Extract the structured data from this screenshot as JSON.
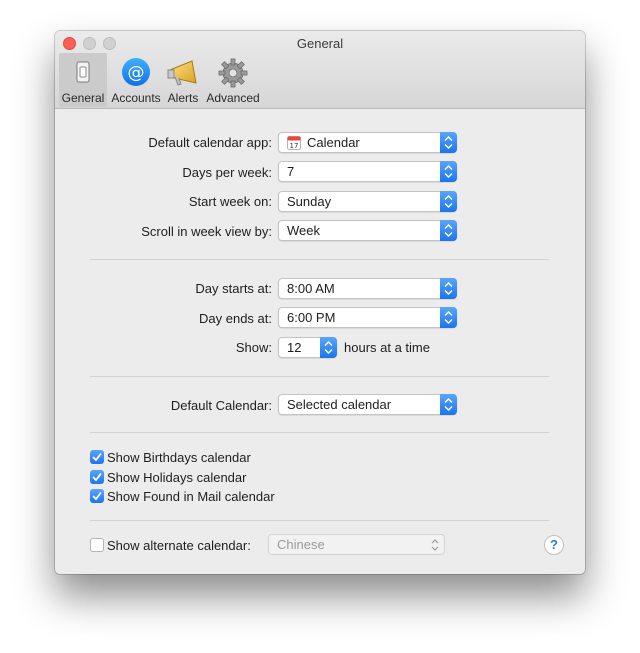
{
  "window": {
    "title": "General"
  },
  "tabs": [
    {
      "label": "General",
      "icon": "switch-icon",
      "selected": true
    },
    {
      "label": "Accounts",
      "icon": "at-sign-icon",
      "selected": false
    },
    {
      "label": "Alerts",
      "icon": "megaphone-icon",
      "selected": false
    },
    {
      "label": "Advanced",
      "icon": "gear-icon",
      "selected": false
    }
  ],
  "general": {
    "default_app_label": "Default calendar app:",
    "default_app_value": "Calendar",
    "days_per_week_label": "Days per week:",
    "days_per_week_value": "7",
    "start_week_label": "Start week on:",
    "start_week_value": "Sunday",
    "scroll_label": "Scroll in week view by:",
    "scroll_value": "Week"
  },
  "day": {
    "starts_label": "Day starts at:",
    "starts_value": "8:00 AM",
    "ends_label": "Day ends at:",
    "ends_value": "6:00 PM",
    "show_label": "Show:",
    "show_value": "12",
    "show_suffix": "hours at a time"
  },
  "default_calendar": {
    "label": "Default Calendar:",
    "value": "Selected calendar"
  },
  "checkboxes": [
    {
      "label": "Show Birthdays calendar",
      "checked": true
    },
    {
      "label": "Show Holidays calendar",
      "checked": true
    },
    {
      "label": "Show Found in Mail calendar",
      "checked": true
    }
  ],
  "alternate": {
    "label": "Show alternate calendar:",
    "checked": false,
    "value": "Chinese"
  },
  "help": {
    "glyph": "?"
  },
  "colors": {
    "accent": "#1d76ef",
    "close": "#fc5f57"
  }
}
